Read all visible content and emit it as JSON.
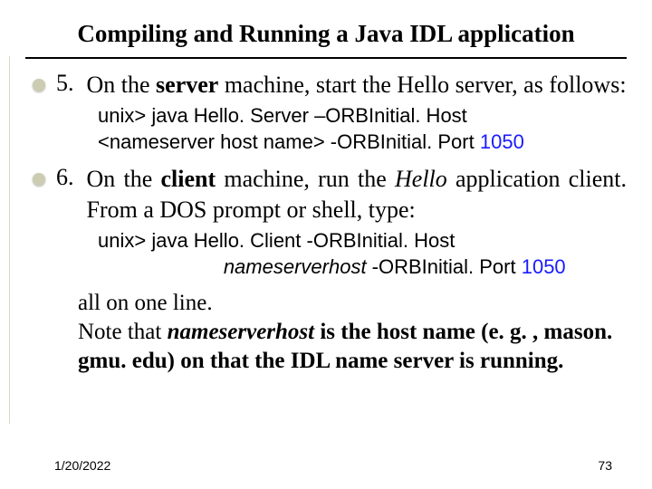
{
  "title": "Compiling and Running a Java IDL application",
  "items": [
    {
      "num": "5.",
      "text_pre": "On the ",
      "text_bold": "server",
      "text_post": " machine, start the Hello server, as follows:",
      "cmd_prefix": "unix> ",
      "cmd_line1": "java Hello. Server –ORBInitial. Host",
      "cmd_line2a": "<nameserver host name> -ORBInitial. Port ",
      "cmd_port": "1050"
    },
    {
      "num": "6.",
      "text_pre": "On the ",
      "text_bold": "client",
      "text_mid": " machine, run the ",
      "text_italic": "Hello",
      "text_post": " application client. From a DOS prompt or shell, type:",
      "cmd_prefix": "unix> ",
      "cmd_a": "java Hello. Client -ORBInitial. Host",
      "cmd_b_italic": "nameserverhost",
      "cmd_b_rest": " -ORBInitial. Port ",
      "cmd_port": "1050"
    }
  ],
  "note": {
    "line1": "all on one line.",
    "line2_pre": "Note that ",
    "line2_italic": "nameserverhost",
    "line2_post": " is the host name (e. g. , mason. gmu. edu) on that the IDL name server is running."
  },
  "footer": {
    "date": "1/20/2022",
    "page": "73"
  }
}
